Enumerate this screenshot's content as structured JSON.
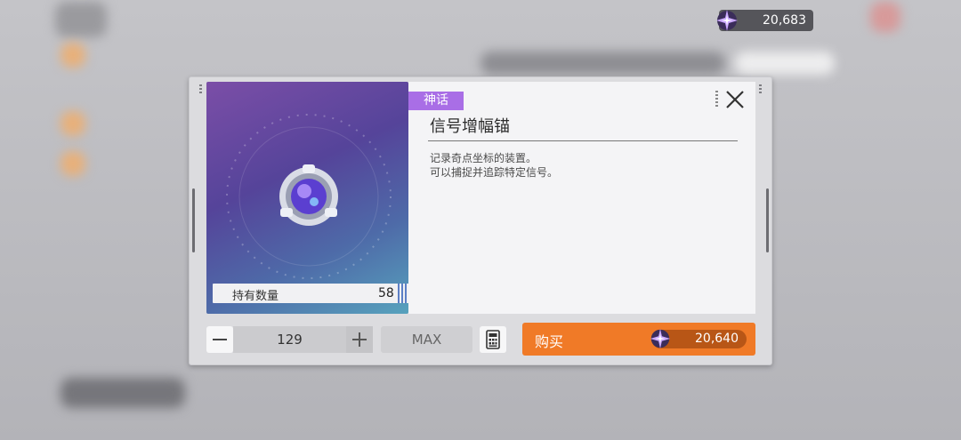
{
  "currency": {
    "icon": "star-crystal-icon",
    "amount": "20,683"
  },
  "item": {
    "rarity": "神话",
    "name": "信号增幅锚",
    "description_lines": [
      "记录奇点坐标的装置。",
      "可以捕捉并追踪特定信号。"
    ],
    "owned_label": "持有数量",
    "owned_count": "58"
  },
  "purchase": {
    "quantity": "129",
    "max_label": "MAX",
    "buy_label": "购买",
    "price": "20,640",
    "price_icon": "star-crystal-icon"
  },
  "colors": {
    "rarity": "#a96ee6",
    "buy_button": "#f07a27",
    "price_pill": "#b85616"
  }
}
